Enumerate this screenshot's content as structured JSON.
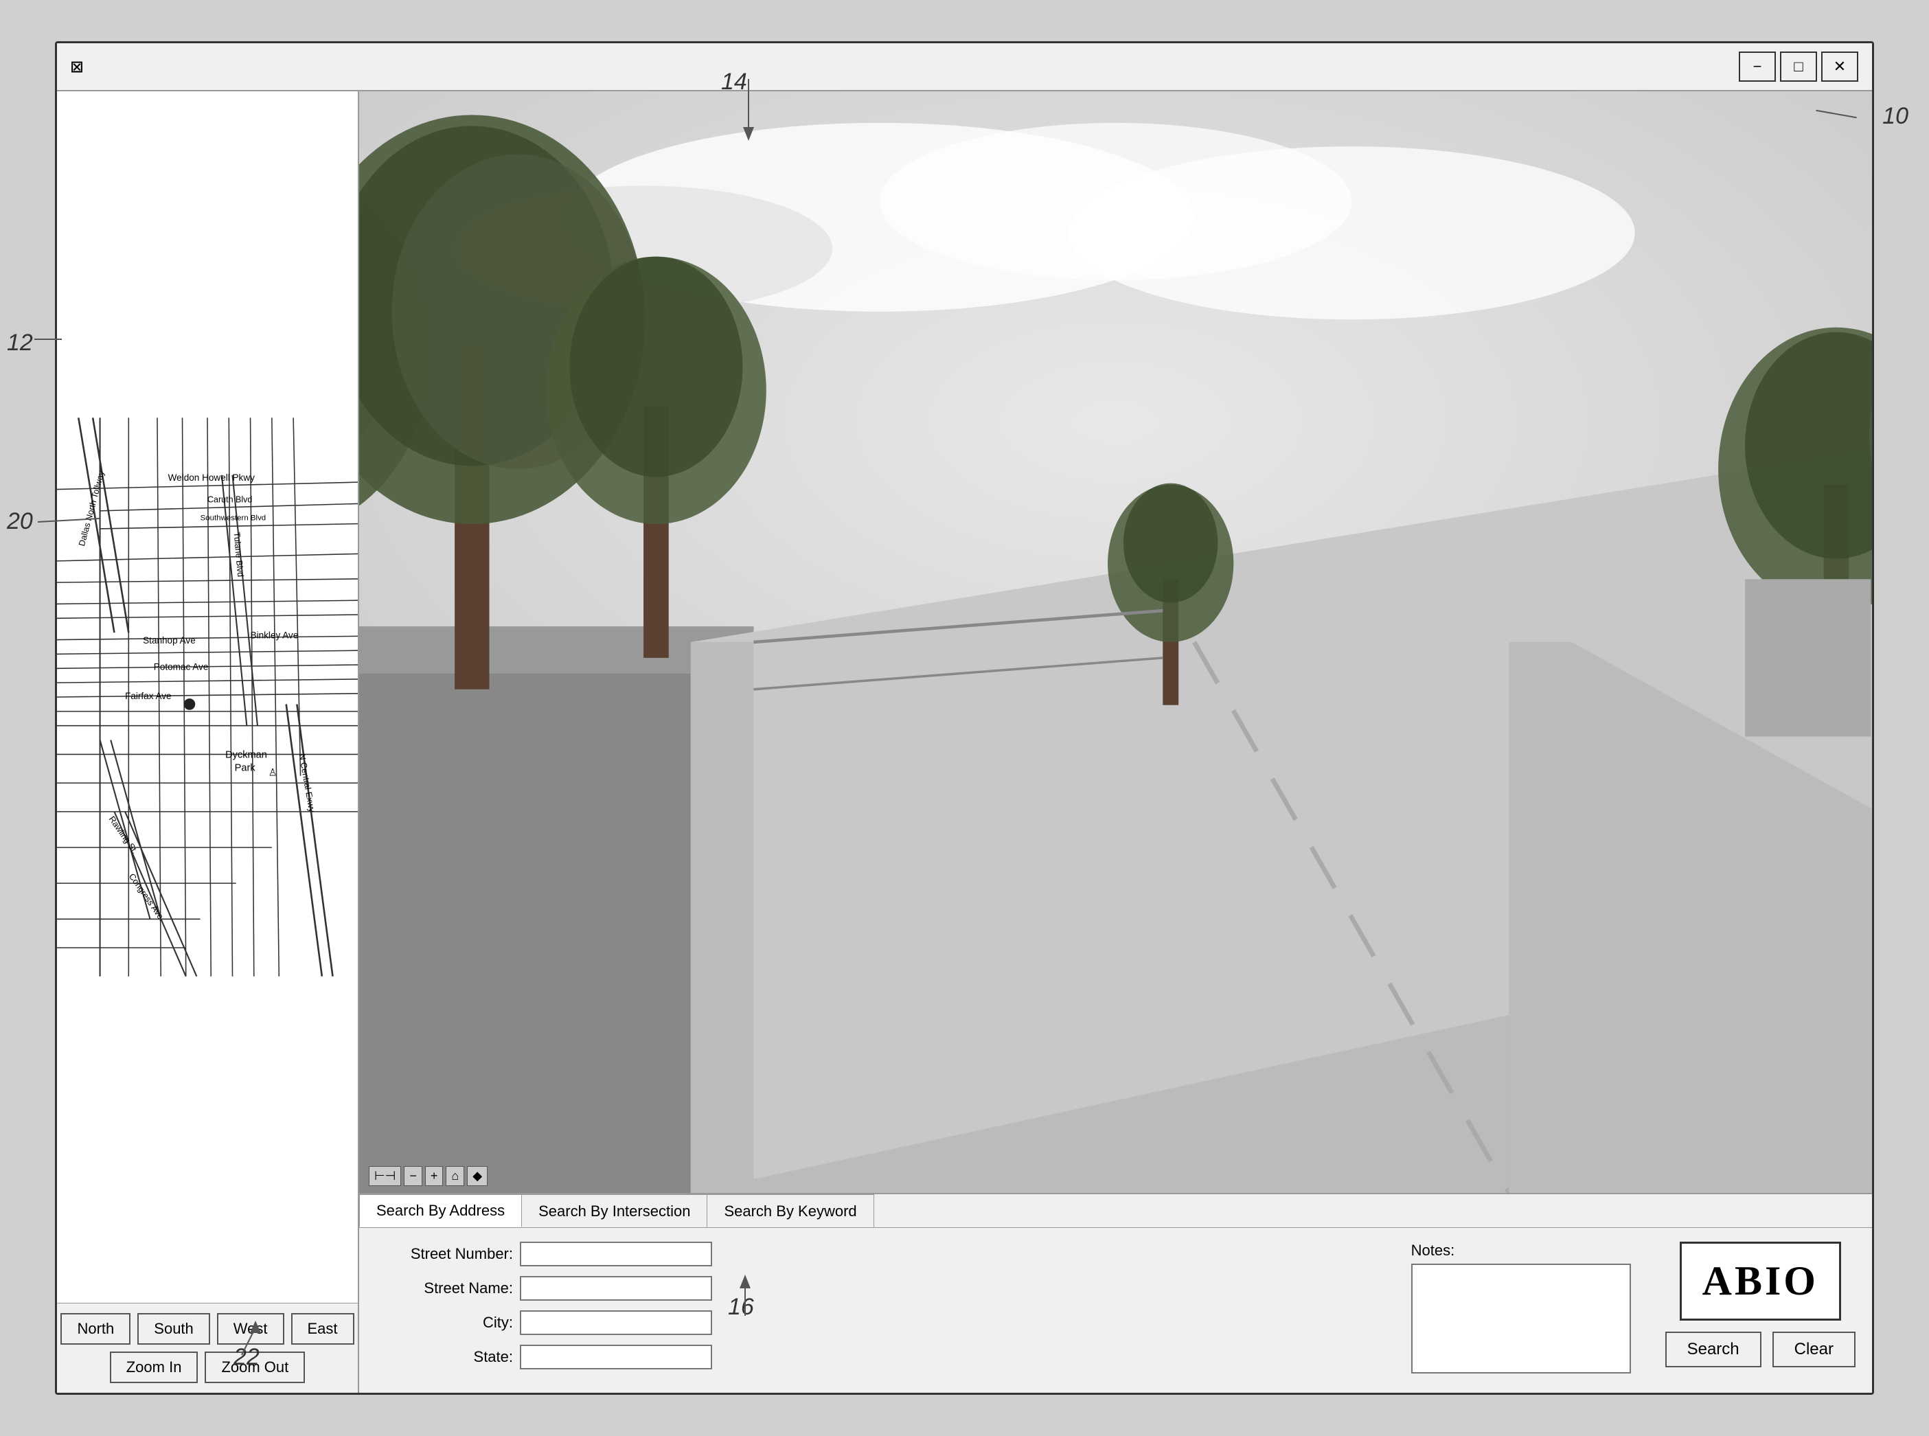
{
  "window": {
    "title": "",
    "logo_symbol": "⊠"
  },
  "window_controls": {
    "minimize": "−",
    "maximize": "□",
    "close": "✕"
  },
  "map": {
    "label": "12",
    "location_dot_label": "20",
    "streets": [
      "Weldon Howell Pkwy",
      "Caruth Blvd",
      "Southwestern Blvd",
      "Dallas North Tollway",
      "Tulane Blvd",
      "Stanhop Ave",
      "Binkley Ave",
      "Potomac Ave",
      "Fairfax Ave",
      "Dyckman Park",
      "Rawling St",
      "N Central Exwy",
      "Congress Ave"
    ],
    "nav_buttons": {
      "north": "North",
      "south": "South",
      "west": "West",
      "east": "East"
    },
    "zoom_buttons": {
      "zoom_in": "Zoom In",
      "zoom_out": "Zoom Out"
    },
    "zoom_label": "22"
  },
  "street_view": {
    "label": "14",
    "controls": [
      "⊢⊣",
      "−",
      "+",
      "⌂",
      "◆"
    ]
  },
  "search": {
    "tabs": [
      {
        "label": "Search By Address",
        "active": true
      },
      {
        "label": "Search By Intersection",
        "active": false
      },
      {
        "label": "Search By Keyword",
        "active": false
      }
    ],
    "form": {
      "street_number_label": "Street Number:",
      "street_name_label": "Street Name:",
      "city_label": "City:",
      "state_label": "State:",
      "notes_label": "Notes:"
    },
    "logo": "ABIO",
    "search_button": "Search",
    "clear_button": "Clear",
    "ref_label": "16"
  },
  "annotations": {
    "ref_10": "10",
    "ref_12": "12",
    "ref_14": "14",
    "ref_16": "16",
    "ref_20": "20",
    "ref_22": "22"
  }
}
